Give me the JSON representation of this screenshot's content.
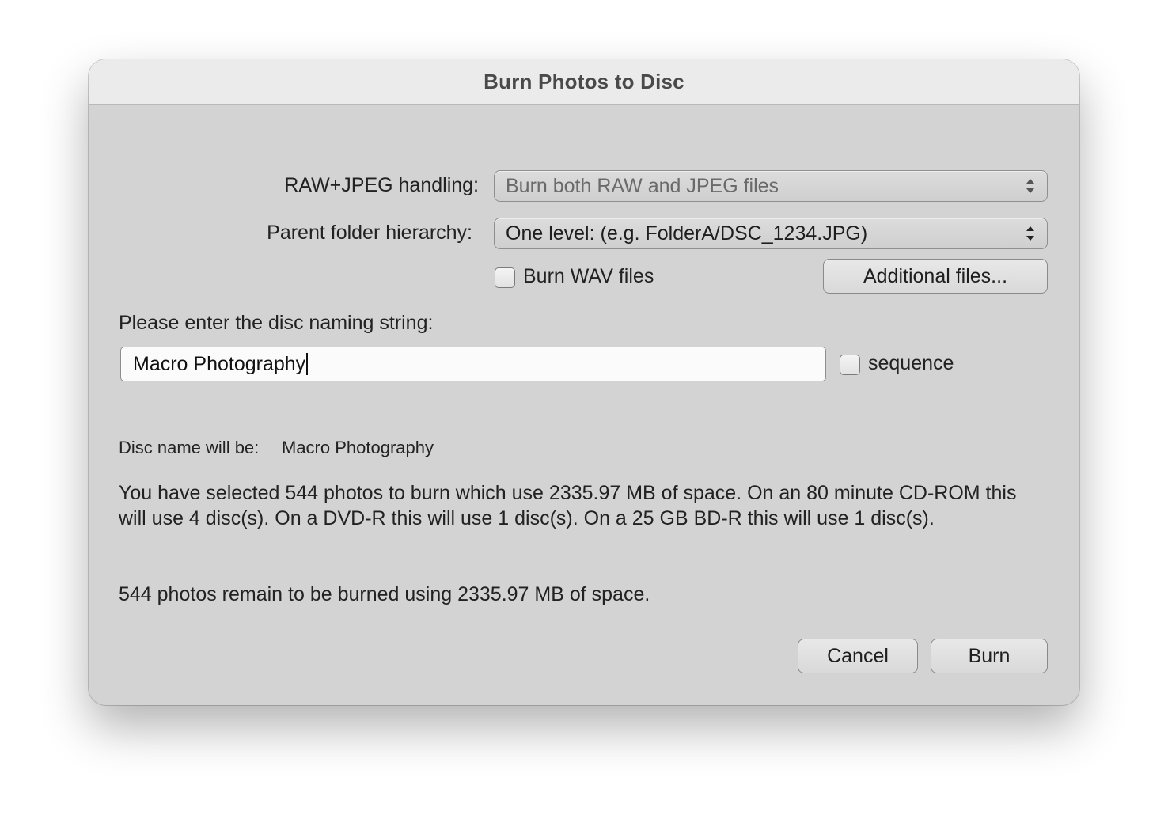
{
  "dialog": {
    "title": "Burn Photos to Disc"
  },
  "raw_jpeg": {
    "label": "RAW+JPEG handling:",
    "value": "Burn both RAW and JPEG files"
  },
  "parent_folder": {
    "label": "Parent folder hierarchy:",
    "value": "One level: (e.g. FolderA/DSC_1234.JPG)"
  },
  "burn_wav": {
    "label": "Burn WAV files",
    "checked": false
  },
  "additional_files_label": "Additional files...",
  "naming": {
    "prompt": "Please enter the disc naming string:",
    "value": "Macro Photography",
    "sequence_label": "sequence",
    "sequence_checked": false
  },
  "disc_name": {
    "label": "Disc name will be:",
    "value": "Macro Photography"
  },
  "summary": {
    "selected_text": "You have selected 544 photos to burn which use 2335.97 MB of space.  On an 80 minute CD-ROM this will use 4 disc(s).  On a DVD-R this will use 1 disc(s).  On a 25 GB BD-R this will use 1 disc(s).",
    "remaining_text": "544 photos remain to be burned using 2335.97 MB of space."
  },
  "buttons": {
    "cancel": "Cancel",
    "burn": "Burn"
  }
}
